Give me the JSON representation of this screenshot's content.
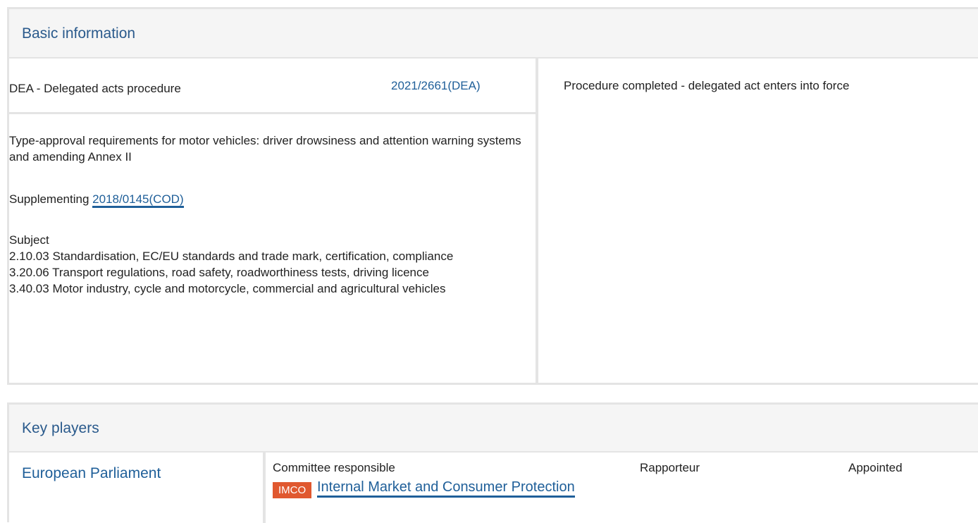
{
  "basic": {
    "title": "Basic information",
    "procedure_type": "DEA - Delegated acts procedure",
    "procedure_ref": "2021/2661(DEA)",
    "status": "Procedure completed - delegated act enters into force",
    "description": "Type-approval requirements for motor vehicles: driver drowsiness and attention warning systems and amending Annex II",
    "supplementing_label": "Supplementing",
    "supplementing_ref": "2018/0145(COD)",
    "subject_label": "Subject",
    "subjects": [
      "2.10.03 Standardisation, EC/EU standards and trade mark, certification, compliance",
      "3.20.06 Transport regulations, road safety, roadworthiness tests, driving licence",
      "3.40.03 Motor industry, cycle and motorcycle, commercial and agricultural vehicles"
    ]
  },
  "key_players": {
    "title": "Key players",
    "institution": "European Parliament",
    "columns": {
      "committee": "Committee responsible",
      "rapporteur": "Rapporteur",
      "appointed": "Appointed"
    },
    "committee_code": "IMCO",
    "committee_name": "Internal Market and Consumer Protection"
  }
}
